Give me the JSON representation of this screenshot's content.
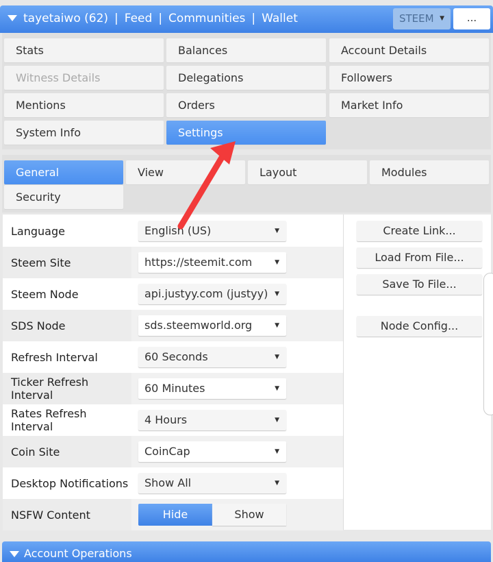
{
  "header": {
    "user": "tayetaiwo (62)",
    "sep": "|",
    "nav": [
      "Feed",
      "Communities",
      "Wallet"
    ],
    "currency": "STEEM",
    "more": "..."
  },
  "main_tabs": [
    {
      "label": "Stats",
      "state": "normal"
    },
    {
      "label": "Balances",
      "state": "normal"
    },
    {
      "label": "Account Details",
      "state": "normal"
    },
    {
      "label": "Witness Details",
      "state": "disabled"
    },
    {
      "label": "Delegations",
      "state": "normal"
    },
    {
      "label": "Followers",
      "state": "normal"
    },
    {
      "label": "Mentions",
      "state": "normal"
    },
    {
      "label": "Orders",
      "state": "normal"
    },
    {
      "label": "Market Info",
      "state": "normal"
    },
    {
      "label": "System Info",
      "state": "normal"
    },
    {
      "label": "Settings",
      "state": "active"
    }
  ],
  "settings_tabs": [
    {
      "label": "General",
      "state": "active"
    },
    {
      "label": "View",
      "state": "normal"
    },
    {
      "label": "Layout",
      "state": "normal"
    },
    {
      "label": "Modules",
      "state": "normal"
    },
    {
      "label": "Security",
      "state": "normal"
    }
  ],
  "settings": [
    {
      "label": "Language",
      "value": "English (US)"
    },
    {
      "label": "Steem Site",
      "value": "https://steemit.com"
    },
    {
      "label": "Steem Node",
      "value": "api.justyy.com (justyy)"
    },
    {
      "label": "SDS Node",
      "value": "sds.steemworld.org"
    },
    {
      "label": "Refresh Interval",
      "value": "60 Seconds"
    },
    {
      "label": "Ticker Refresh Interval",
      "value": "60 Minutes"
    },
    {
      "label": "Rates Refresh Interval",
      "value": "4 Hours"
    },
    {
      "label": "Coin Site",
      "value": "CoinCap"
    },
    {
      "label": "Desktop Notifications",
      "value": "Show All"
    }
  ],
  "nsfw": {
    "label": "NSFW Content",
    "options": [
      "Hide",
      "Show"
    ],
    "selected": "Hide"
  },
  "actions": {
    "create_link": "Create Link...",
    "load_file": "Load From File...",
    "save_file": "Save To File...",
    "node_config": "Node Config..."
  },
  "footer": {
    "title": "Account Operations"
  },
  "colors": {
    "accent": "#4a8ff0",
    "annotation_arrow": "#f23a3a"
  }
}
